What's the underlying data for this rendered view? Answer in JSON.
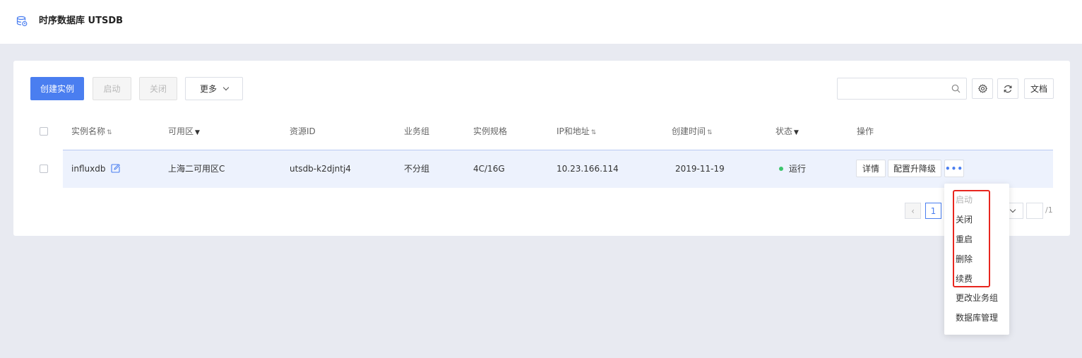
{
  "header": {
    "title": "时序数据库 UTSDB",
    "icon": "database-icon"
  },
  "toolbar": {
    "create_label": "创建实例",
    "start_label": "启动",
    "close_label": "关闭",
    "more_label": "更多",
    "search_placeholder": "",
    "docs_label": "文档"
  },
  "table": {
    "headers": {
      "name": "实例名称",
      "zone": "可用区",
      "resource_id": "资源ID",
      "group": "业务组",
      "spec": "实例规格",
      "ip": "IP和地址",
      "created": "创建时间",
      "status": "状态",
      "ops": "操作"
    },
    "rows": [
      {
        "name": "influxdb",
        "zone": "上海二可用区C",
        "resource_id": "utsdb-k2djntj4",
        "group": "不分组",
        "spec": "4C/16G",
        "ip": "10.23.166.114",
        "created": "2019-11-19",
        "status": "运行",
        "detail_label": "详情",
        "upgrade_label": "配置升降级",
        "more_label": "•••"
      }
    ]
  },
  "pagination": {
    "prev": "‹",
    "current": "1",
    "total": "/1"
  },
  "dropdown": {
    "items": [
      "启动",
      "关闭",
      "重启",
      "删除",
      "续费",
      "更改业务组",
      "数据库管理"
    ]
  },
  "colors": {
    "primary": "#4a7ef0",
    "status_running": "#3cc56c",
    "highlight": "#e8261f"
  }
}
